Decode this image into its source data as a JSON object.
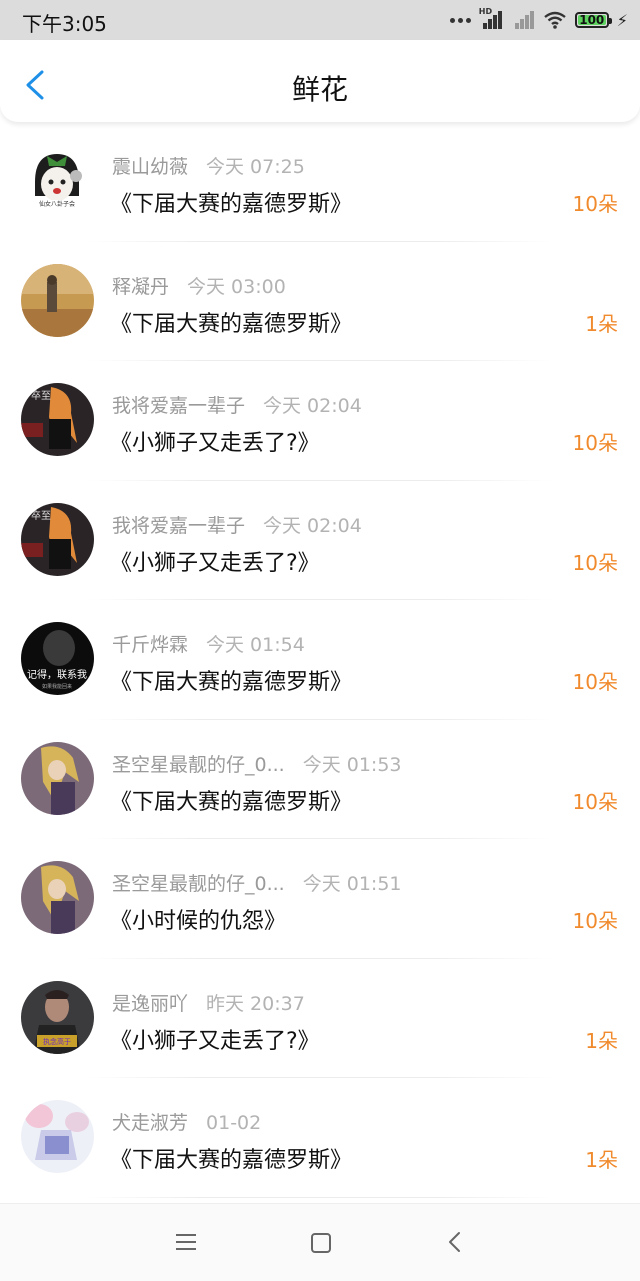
{
  "status_bar": {
    "time": "下午3:05",
    "battery": "100"
  },
  "header": {
    "title": "鲜花"
  },
  "items": [
    {
      "name": "震山幼薇",
      "time": "今天 07:25",
      "work": "《下届大赛的嘉德罗斯》",
      "count": "10朵"
    },
    {
      "name": "释凝丹",
      "time": "今天 03:00",
      "work": "《下届大赛的嘉德罗斯》",
      "count": "1朵"
    },
    {
      "name": "我将爱嘉一辈子",
      "time": "今天 02:04",
      "work": "《小狮子又走丢了?》",
      "count": "10朵"
    },
    {
      "name": "我将爱嘉一辈子",
      "time": "今天 02:04",
      "work": "《小狮子又走丢了?》",
      "count": "10朵"
    },
    {
      "name": "千斤烨霖",
      "time": "今天 01:54",
      "work": "《下届大赛的嘉德罗斯》",
      "count": "10朵"
    },
    {
      "name": "圣空星最靓的仔_0...",
      "time": "今天 01:53",
      "work": "《下届大赛的嘉德罗斯》",
      "count": "10朵"
    },
    {
      "name": "圣空星最靓的仔_0...",
      "time": "今天 01:51",
      "work": "《小时候的仇怨》",
      "count": "10朵"
    },
    {
      "name": "是逸丽吖",
      "time": "昨天 20:37",
      "work": "《小狮子又走丢了?》",
      "count": "1朵"
    },
    {
      "name": "犬走淑芳",
      "time": "01-02",
      "work": "《下届大赛的嘉德罗斯》",
      "count": "1朵"
    }
  ],
  "colors": {
    "accent_blue": "#1e90e8",
    "count_orange": "#f08a2c"
  },
  "icons": {
    "back": "chevron-left-icon",
    "nav_menu": "menu-icon",
    "nav_home": "home-square-icon",
    "nav_back": "back-triangle-icon"
  }
}
